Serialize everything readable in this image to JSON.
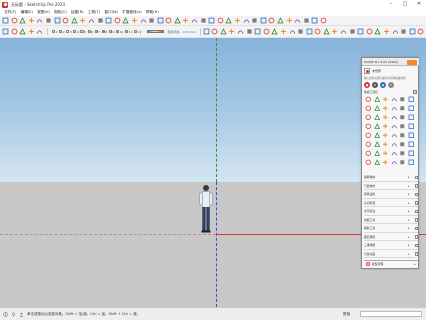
{
  "window": {
    "title": "无标题 - SketchUp Pro 2023",
    "controls": [
      "–",
      "□",
      "✕"
    ]
  },
  "menu": [
    "文件(F)",
    "编辑(E)",
    "视图(V)",
    "相机(C)",
    "绘图(R)",
    "工具(T)",
    "窗口(W)",
    "扩展程序(x)",
    "帮助(H)"
  ],
  "toolbar1": {
    "icons": [
      "search-icon",
      "select-arrow-icon",
      "eraser-icon",
      "pencil-line-icon",
      "arc-icon",
      "rectangle-icon",
      "push-pull-icon",
      "move-icon",
      "rotate-icon",
      "scale-icon",
      "offset-icon",
      "tape-measure-icon",
      "text-icon",
      "paint-bucket-icon",
      "orbit-icon",
      "pan-icon",
      "zoom-icon",
      "zoom-extents-icon",
      "walk-icon",
      "section-plane-icon",
      "component-icon",
      "warehouse-icon",
      "extension-icon",
      "layout-icon",
      "style-icon",
      "shadow-icon",
      "fog-icon",
      "axes-icon",
      "dimension-icon",
      "protractor-icon",
      "look-around-icon",
      "position-camera-icon",
      "solid-tools-icon",
      "sandbox-icon",
      "photo-match-icon",
      "share-icon",
      "ruby-console-icon",
      "settings-icon"
    ]
  },
  "toolbar2": {
    "icons_left": [
      "sphere-icon",
      "cube-icon",
      "circle-icon",
      "polygon-icon",
      "freehand-icon"
    ],
    "cells": [
      "1",
      "2",
      "3",
      "4",
      "5",
      "6",
      "7",
      "8",
      "9",
      "10",
      "11",
      "12"
    ],
    "cell_colors": [
      "#d9d9d9",
      "#b7e1f7",
      "#ffffff",
      "#b8d88b",
      "#ffe27a",
      "#f5b35a",
      "#f28a5a",
      "#e05a4a",
      "#c8c8c8",
      "#8ab8e6",
      "#7cc47c",
      "#f0d060"
    ],
    "unit_text": "颜色风格",
    "unit_text2": "0.00 mm",
    "icons_right": [
      "house-icon",
      "roof-icon",
      "wall-icon",
      "window-icon",
      "door-icon",
      "stair-icon",
      "column-icon",
      "beam-icon",
      "floor-icon",
      "terrain-icon",
      "tree-icon",
      "car-icon",
      "people-icon",
      "render-icon",
      "export-icon",
      "import-icon",
      "layer-icon",
      "outliner-icon",
      "material-icon",
      "entity-info-icon",
      "ruler-icon",
      "camera-icon",
      "light-icon",
      "grid-icon",
      "snap-icon",
      "align-icon"
    ]
  },
  "viewport": {
    "sky_color": "#a9cbe6",
    "ground_color": "#c8c8c9",
    "axis_red": "#d63a2e",
    "axis_green": "#3d8b3d",
    "axis_blue": "#2c55c4"
  },
  "panel": {
    "title": "SUAPP Pro 3.00 (0404)",
    "user": "未登录",
    "search_hint": "输入插件关键字或命令名称快速查找",
    "category_label": "快捷工具栏",
    "tab_colors": [
      "#d63a2e",
      "#555555",
      "#2e6fc7",
      "#888888"
    ],
    "tab_glyphs": [
      "●",
      "★",
      "◆",
      "?"
    ],
    "grid_icons": [
      "red-gear-icon",
      "wave-icon",
      "square-icon",
      "grid-icon",
      "flag-icon",
      "hexagon-icon",
      "zigzag-icon",
      "circle-icon",
      "star-icon",
      "grid-icon",
      "arrow-icon",
      "hook-icon",
      "bulb-icon",
      "wrench-icon",
      "x-icon",
      "chain-icon",
      "puzzle-icon",
      "stick-icon",
      "spring-icon",
      "bridge-icon",
      "curve-icon",
      "leaf-icon",
      "bend-icon",
      "box-icon",
      "red-curve-icon",
      "arc-icon",
      "node-icon",
      "scissors-icon",
      "gear-icon",
      "wave-icon",
      "stair-icon",
      "trident-icon",
      "star-icon",
      "mirror-icon",
      "door-icon",
      "roof-icon",
      "bottle-icon",
      "cross-icon",
      "camera-icon",
      "chair-icon",
      "red-box-icon",
      "ring-icon",
      "vase-icon",
      "grid-icon",
      "paint-icon",
      "weave-icon",
      "saw-icon",
      "rope-icon"
    ],
    "rows": [
      "轴网墙体",
      "门窗构件",
      "建筑设施",
      "房间屋顶",
      "文字标注",
      "线面工具",
      "辅助工具",
      "图层群组",
      "三维体量",
      "渲染动画"
    ],
    "bottom_label": "模型清理"
  },
  "statusbar": {
    "hint": "单击或拖动以选择对象。Shift = 加/减。Ctrl = 加。Shift + Ctrl = 减。",
    "measure_label": "数值"
  }
}
